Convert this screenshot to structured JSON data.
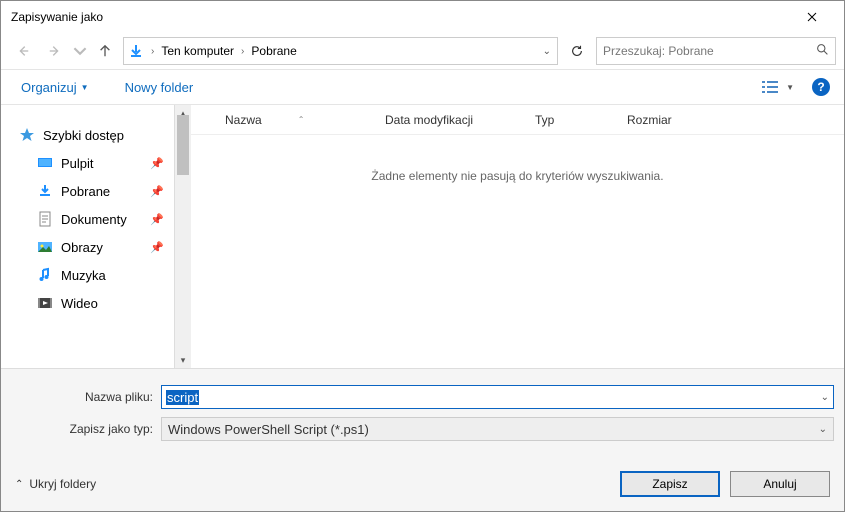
{
  "window": {
    "title": "Zapisywanie jako"
  },
  "path": {
    "root": "Ten komputer",
    "folder": "Pobrane"
  },
  "search": {
    "placeholder": "Przeszukaj: Pobrane"
  },
  "toolbar": {
    "organize": "Organizuj",
    "newfolder": "Nowy folder"
  },
  "columns": {
    "name": "Nazwa",
    "date": "Data modyfikacji",
    "type": "Typ",
    "size": "Rozmiar"
  },
  "empty_msg": "Żadne elementy nie pasują do kryteriów wyszukiwania.",
  "sidebar": {
    "quick": "Szybki dostęp",
    "items": [
      {
        "label": "Pulpit"
      },
      {
        "label": "Pobrane"
      },
      {
        "label": "Dokumenty"
      },
      {
        "label": "Obrazy"
      },
      {
        "label": "Muzyka"
      },
      {
        "label": "Wideo"
      }
    ]
  },
  "form": {
    "filename_label": "Nazwa pliku:",
    "filename_value": "script",
    "filetype_label": "Zapisz jako typ:",
    "filetype_value": "Windows PowerShell Script (*.ps1)"
  },
  "footer": {
    "hide_folders": "Ukryj foldery",
    "save": "Zapisz",
    "cancel": "Anuluj"
  }
}
